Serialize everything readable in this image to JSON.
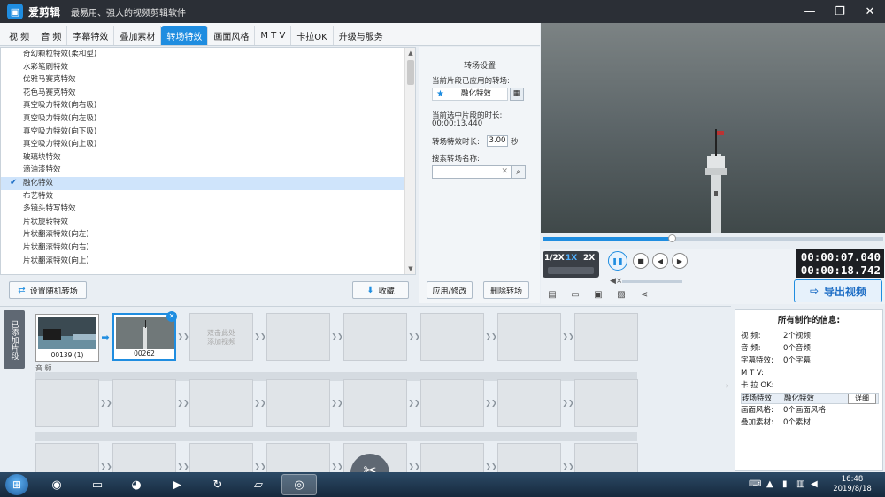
{
  "window": {
    "app_name": "爱剪辑",
    "slogan": "最易用、强大的视频剪辑软件",
    "controls": {
      "minimize": "—",
      "maximize": "❐",
      "close": "✕"
    }
  },
  "tabs": [
    {
      "label": "视 频"
    },
    {
      "label": "音 频"
    },
    {
      "label": "字幕特效"
    },
    {
      "label": "叠加素材"
    },
    {
      "label": "转场特效",
      "active": true
    },
    {
      "label": "画面风格"
    },
    {
      "label": "M T V"
    },
    {
      "label": "卡拉OK"
    },
    {
      "label": "升级与服务"
    }
  ],
  "effects": [
    "奇幻颗粒特效(柔和型)",
    "水彩笔刷特效",
    "优雅马赛克特效",
    "花色马赛克特效",
    "真空吸力特效(向右吸)",
    "真空吸力特效(向左吸)",
    "真空吸力特效(向下吸)",
    "真空吸力特效(向上吸)",
    "玻璃块特效",
    "滴油漆特效",
    "融化特效",
    "布艺特效",
    "多镜头特写特效",
    "片状旋转特效",
    "片状翻滚特效(向左)",
    "片状翻滚特效(向右)",
    "片状翻滚特效(向上)"
  ],
  "selected_effect_index": 10,
  "list_buttons": {
    "random": "设置随机转场",
    "favorite": "收藏"
  },
  "settings": {
    "title": "转场设置",
    "applied_label": "当前片段已应用的转场:",
    "applied_value": "融化特效",
    "duration_label": "当前选中片段的时长:",
    "duration_value": "00:00:13.440",
    "effect_duration_label": "转场特效时长:",
    "effect_duration_value": "3.00",
    "effect_duration_unit": "秒",
    "search_label": "搜索转场名称:",
    "search_value": "",
    "apply_button": "应用/修改",
    "delete_button": "删除转场"
  },
  "player": {
    "progress": 0.38,
    "speeds": [
      "1/2X",
      "1X",
      "2X"
    ],
    "active_speed": "1X",
    "time_current": "00:00:07.040",
    "time_total": "00:00:18.742",
    "export_label": "导出视频"
  },
  "timeline": {
    "side_label": "已添加片段",
    "clips": [
      {
        "name": "00139 (1)"
      },
      {
        "name": "00262"
      }
    ],
    "add_hint": "双击此处\n添加视频",
    "audio_label": "音 频"
  },
  "info": {
    "title": "所有制作的信息:",
    "rows": [
      {
        "key": "视  频:",
        "value": "2个视频"
      },
      {
        "key": "音  频:",
        "value": "0个音频"
      },
      {
        "key": "字幕特效:",
        "value": "0个字幕"
      },
      {
        "key": "M T V:",
        "value": ""
      },
      {
        "key": "卡 拉 OK:",
        "value": ""
      },
      {
        "key": "转场特效:",
        "value": "融化特效"
      },
      {
        "key": "画面风格:",
        "value": "0个画面风格"
      },
      {
        "key": "叠加素材:",
        "value": "0个素材"
      }
    ],
    "highlight_index": 5,
    "detail_button": "详细"
  },
  "taskbar": {
    "time": "16:48",
    "date": "2019/8/18"
  },
  "colors": {
    "accent": "#1f8de0",
    "titlebar": "#2b2f36",
    "selection": "#cfe4fb"
  }
}
